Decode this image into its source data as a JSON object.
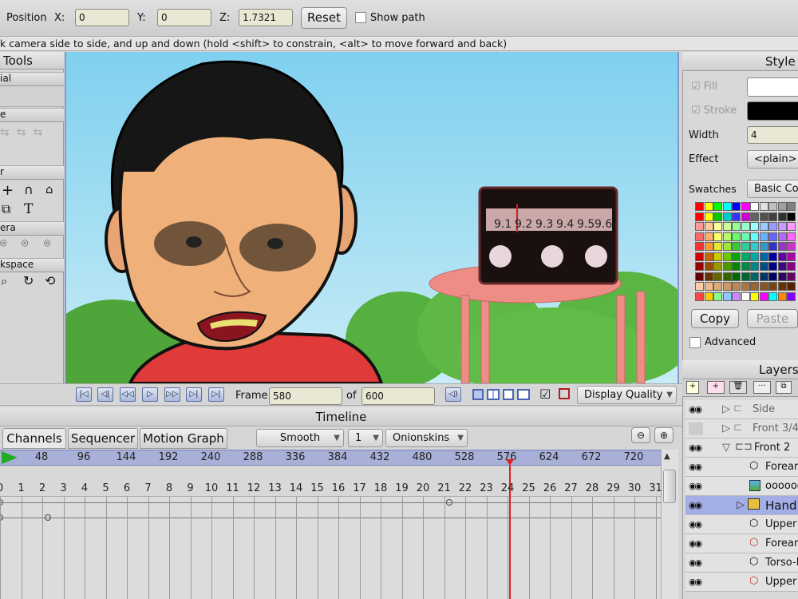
{
  "toolbar": {
    "position_label": "Position",
    "x_label": "X:",
    "x_value": "0",
    "y_label": "Y:",
    "y_value": "0",
    "z_label": "Z:",
    "z_value": "1.7321",
    "reset_label": "Reset",
    "show_path_label": "Show path"
  },
  "status_hint": "k camera side to side, and up and down (hold <shift> to constrain, <alt> to move forward and back)",
  "tools_panel": {
    "title": "Tools",
    "sections": [
      "ial",
      "e",
      "r",
      "era",
      "kspace"
    ]
  },
  "canvas": {
    "radio_dial": [
      "9.1",
      "9.2",
      "9.3",
      "9.4",
      "9.5",
      "9.6"
    ]
  },
  "playback": {
    "frame_label": "Frame",
    "frame_value": "580",
    "of_label": "of",
    "total_value": "600",
    "display_quality_label": "Display Quality"
  },
  "timeline": {
    "title": "Timeline",
    "tabs": [
      "Channels",
      "Sequencer",
      "Motion Graph"
    ],
    "interpolation": "Smooth",
    "step": "1",
    "onionskins": "Onionskins",
    "ruler_labels": [
      "48",
      "96",
      "144",
      "192",
      "240",
      "288",
      "336",
      "384",
      "432",
      "480",
      "528",
      "576",
      "624",
      "672",
      "720"
    ],
    "frame_numbers": [
      "0",
      "1",
      "2",
      "3",
      "4",
      "5",
      "6",
      "7",
      "8",
      "9",
      "10",
      "11",
      "12",
      "13",
      "14",
      "15",
      "16",
      "17",
      "18",
      "19",
      "20",
      "21",
      "22",
      "23",
      "24",
      "25",
      "26",
      "27",
      "28",
      "29",
      "30",
      "31"
    ]
  },
  "style_panel": {
    "title": "Style",
    "fill_label": "Fill",
    "stroke_label": "Stroke",
    "width_label": "Width",
    "width_value": "4",
    "effect_label": "Effect",
    "effect_value": "<plain>",
    "swatches_label": "Swatches",
    "swatches_value": "Basic Co",
    "copy_label": "Copy",
    "paste_label": "Paste",
    "advanced_label": "Advanced",
    "fill_color": "#ffffff",
    "stroke_color": "#000000"
  },
  "layers_panel": {
    "title": "Layers",
    "items": [
      {
        "name": "Side"
      },
      {
        "name": "Front 3/4"
      },
      {
        "name": "Front 2"
      },
      {
        "name": "Forearm"
      },
      {
        "name": "oooooo"
      },
      {
        "name": "Hand"
      },
      {
        "name": "Upper"
      },
      {
        "name": "Forearm"
      },
      {
        "name": "Torso-F"
      },
      {
        "name": "Upper"
      }
    ]
  },
  "colors": {
    "ruler_bg": "#a8b0d8",
    "selected_layer": "#a3aee6",
    "playhead": "#e02020"
  }
}
